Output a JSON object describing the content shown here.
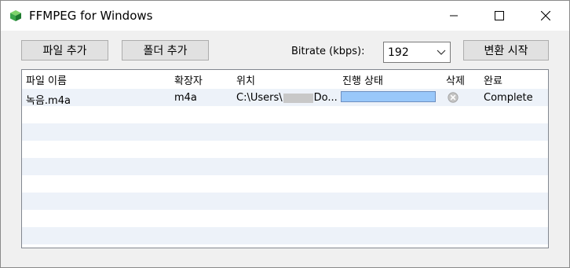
{
  "window": {
    "title": "FFMPEG for Windows",
    "controls": {
      "minimize_icon": "minimize-icon",
      "maximize_icon": "maximize-icon",
      "close_icon": "close-icon"
    }
  },
  "toolbar": {
    "add_file_label": "파일 추가",
    "add_folder_label": "폴더 추가",
    "bitrate_label": "Bitrate (kbps):",
    "bitrate_value": "192",
    "start_label": "변환 시작"
  },
  "list": {
    "columns": [
      "파일 이름",
      "확장자",
      "위치",
      "진행 상태",
      "삭제",
      "완료"
    ],
    "rows": [
      {
        "name": "녹음.m4a",
        "ext": "m4a",
        "path_prefix": "C:\\Users\\",
        "path_suffix": "Do...",
        "progress": 1.0,
        "delete_icon": "delete-icon",
        "status": "Complete"
      }
    ]
  },
  "colors": {
    "stripe": "#edf2f9",
    "progress_fill": "#99c8fa",
    "app_icon": "#3aa64a"
  }
}
